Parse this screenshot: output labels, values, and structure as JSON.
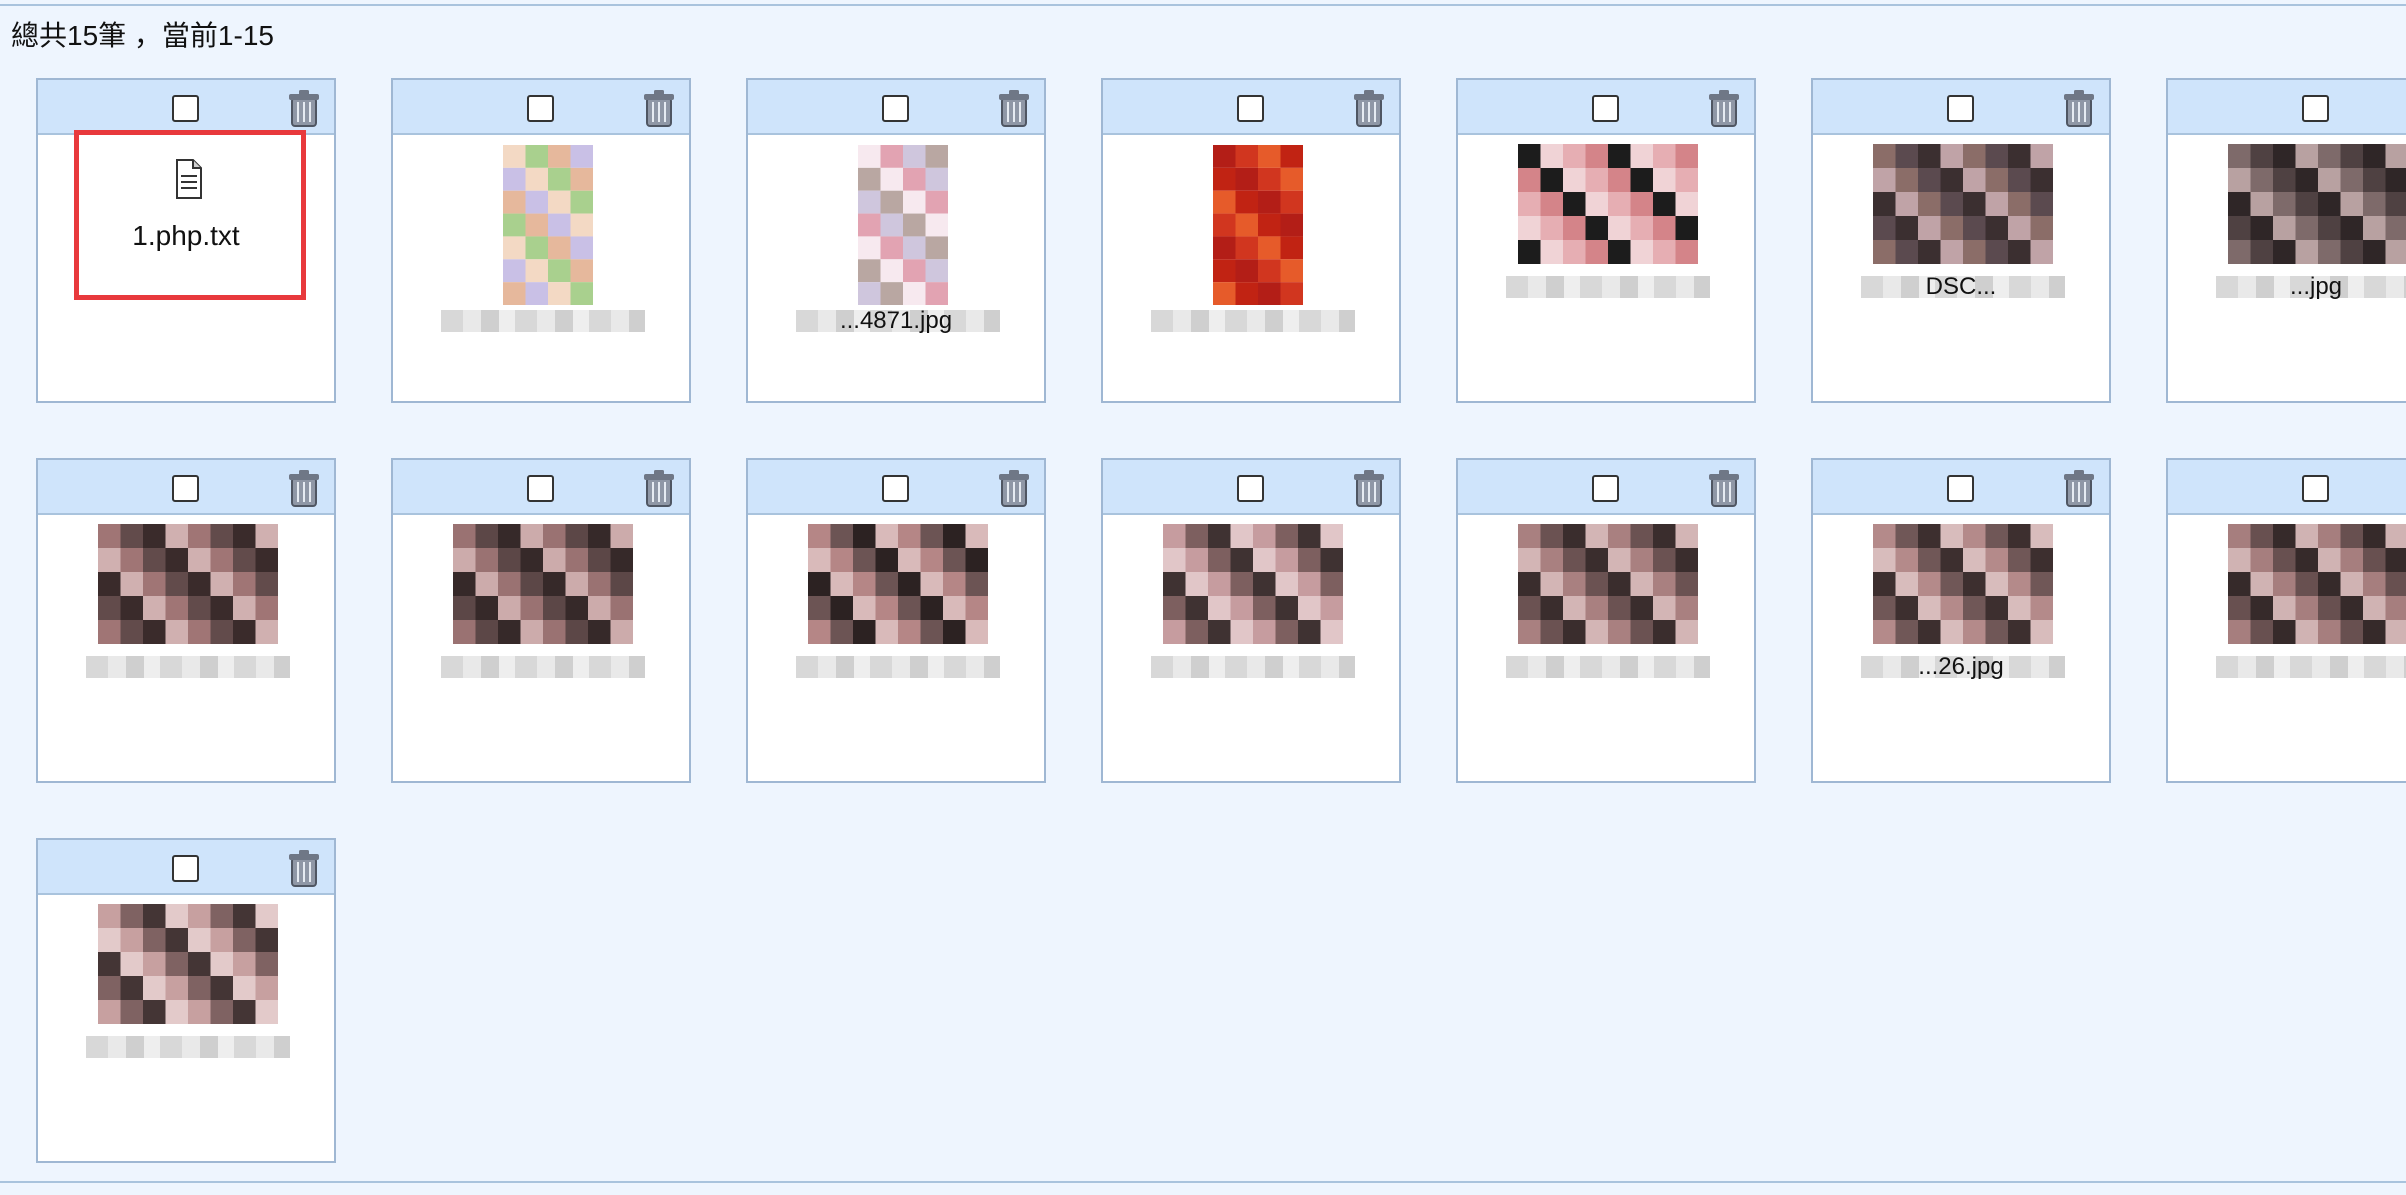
{
  "summary": "總共15筆 ，當前1-15",
  "files": [
    {
      "name": "1.php.txt",
      "kind": "file",
      "selected": false
    },
    {
      "name": "",
      "kind": "image",
      "selected": false,
      "palette": [
        "#f3d9c4",
        "#a9d08e",
        "#e6b89c",
        "#c9c0e6"
      ],
      "shape": "tall"
    },
    {
      "name": "...4871.jpg",
      "kind": "image",
      "selected": false,
      "palette": [
        "#f7e9ef",
        "#e2a3b2",
        "#cfc6dd",
        "#b9a7a2"
      ],
      "shape": "tall"
    },
    {
      "name": "",
      "kind": "image",
      "selected": false,
      "palette": [
        "#b31e17",
        "#d1361f",
        "#e65b2a",
        "#c12313"
      ],
      "shape": "tall"
    },
    {
      "name": "",
      "kind": "image",
      "selected": false,
      "palette": [
        "#1c1c1c",
        "#f0d3d6",
        "#e6aeb3",
        "#d48489"
      ],
      "shape": "wide"
    },
    {
      "name": "DSC...",
      "kind": "image",
      "selected": false,
      "palette": [
        "#8b6d68",
        "#5b4a4f",
        "#3b2f30",
        "#c0a3a7"
      ],
      "shape": "wide"
    },
    {
      "name": "...jpg",
      "kind": "image",
      "selected": false,
      "palette": [
        "#7e6a6a",
        "#4f4142",
        "#2f2627",
        "#b8a1a1"
      ],
      "shape": "wide"
    },
    {
      "name": "",
      "kind": "image",
      "selected": false,
      "palette": [
        "#a07575",
        "#624b4b",
        "#3a2b2b",
        "#d0b0b0"
      ],
      "shape": "wide"
    },
    {
      "name": "",
      "kind": "image",
      "selected": false,
      "palette": [
        "#9a7272",
        "#5c4747",
        "#362929",
        "#ccabab"
      ],
      "shape": "wide"
    },
    {
      "name": "",
      "kind": "image",
      "selected": false,
      "palette": [
        "#b58686",
        "#6c5454",
        "#2c2222",
        "#d9baba"
      ],
      "shape": "wide"
    },
    {
      "name": "",
      "kind": "image",
      "selected": false,
      "palette": [
        "#c69c9f",
        "#7d5f5f",
        "#3f3232",
        "#e1c6c8"
      ],
      "shape": "wide"
    },
    {
      "name": "",
      "kind": "image",
      "selected": false,
      "palette": [
        "#a98080",
        "#6b5252",
        "#3a2d2d",
        "#d3b5b5"
      ],
      "shape": "wide"
    },
    {
      "name": "...26.jpg",
      "kind": "image",
      "selected": false,
      "palette": [
        "#b48a8a",
        "#705757",
        "#3d2f2f",
        "#d8bcbc"
      ],
      "shape": "wide"
    },
    {
      "name": "",
      "kind": "image",
      "selected": false,
      "palette": [
        "#a67e7e",
        "#685050",
        "#362a2a",
        "#d0b3b3"
      ],
      "shape": "wide"
    },
    {
      "name": "",
      "kind": "image",
      "selected": false,
      "palette": [
        "#c7a0a0",
        "#7f6262",
        "#443535",
        "#e3caca"
      ],
      "shape": "wide"
    }
  ],
  "colors": {
    "header": "#cfe4fb",
    "border": "#9fb7d3",
    "highlight": "#e8393c"
  },
  "icons": {
    "delete": "trash-icon",
    "file": "document-icon"
  }
}
